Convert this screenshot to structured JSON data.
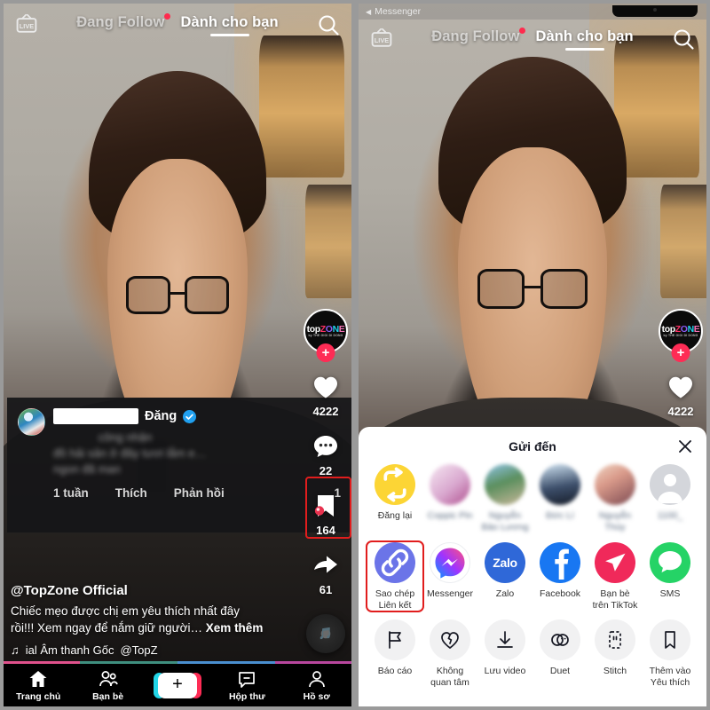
{
  "app": {
    "name": "TikTok"
  },
  "left_panel": {
    "topnav": {
      "live_label": "LIVE",
      "tab_following": "Đang Follow",
      "tab_foryou": "Dành cho bạn",
      "search_icon": "search-icon"
    },
    "rail": {
      "avatar_logo_top": "top",
      "avatar_logo_z": "Z",
      "avatar_logo_o": "O",
      "avatar_logo_n": "N",
      "avatar_logo_e": "E",
      "avatar_sub": "by THE GIOI DI DONG",
      "follow_label": "+",
      "like_count": "4222",
      "comment_count": "22",
      "bookmark_count": "164",
      "share_count": "61"
    },
    "comment": {
      "name": "Đăng",
      "verified": true,
      "text_line1": "công nhận",
      "text_line2": "đồ hải sản ở đây tươi lắm e…",
      "text_line3": "ngon đã man",
      "time": "1 tuần",
      "like_label": "Thích",
      "reply_label": "Phản hồi",
      "like_count": "1"
    },
    "caption": {
      "username": "@TopZone Official",
      "line1": "Chiếc mẹo được chị em yêu thích nhất đây",
      "line2": "rồi!!! Xem ngay để nắm giữ người…",
      "more": "Xem thêm",
      "music_icon": "music-note-icon",
      "music_title": "ial Âm thanh Gốc",
      "music_author": "@TopZ"
    },
    "progress_segments": [
      {
        "color": "#e0518c",
        "width": 22
      },
      {
        "color": "#3f8f7f",
        "width": 28
      },
      {
        "color": "#4a8fd0",
        "width": 28
      },
      {
        "color": "#b8469e",
        "width": 22
      }
    ],
    "bottomnav": [
      {
        "label": "Trang chủ",
        "icon": "home-icon"
      },
      {
        "label": "Bạn bè",
        "icon": "friends-icon"
      },
      {
        "label": "+",
        "icon": "create-icon"
      },
      {
        "label": "Hộp thư",
        "icon": "inbox-icon"
      },
      {
        "label": "Hồ sơ",
        "icon": "profile-icon"
      }
    ]
  },
  "right_panel": {
    "status_bar": {
      "back_icon": "back-triangle-icon",
      "app_label": "Messenger"
    },
    "topnav": {
      "live_label": "LIVE",
      "tab_following": "Đang Follow",
      "tab_foryou": "Dành cho bạn",
      "search_icon": "search-icon"
    },
    "rail": {
      "avatar_logo_top": "top",
      "avatar_logo_z": "Z",
      "avatar_logo_o": "O",
      "avatar_logo_n": "N",
      "avatar_logo_e": "E",
      "avatar_sub": "by THE GIOI DI DONG",
      "follow_label": "+",
      "like_count": "4222"
    },
    "share_sheet": {
      "title": "Gửi đến",
      "close_icon": "close-icon",
      "contacts": [
        {
          "label": "Đăng lại",
          "icon": "repost-icon",
          "style": "repost",
          "blurred": false
        },
        {
          "label": "Coppic Pin",
          "icon": "avatar",
          "style": "ph1",
          "blurred": true
        },
        {
          "label": "Nguyễn\nBảo Lương",
          "icon": "avatar",
          "style": "ph2",
          "blurred": true
        },
        {
          "label": "Đức Lí",
          "icon": "avatar",
          "style": "ph3",
          "blurred": true
        },
        {
          "label": "Nguyễn\nThúy",
          "icon": "avatar",
          "style": "ph4",
          "blurred": true
        },
        {
          "label": "1100_",
          "icon": "person-icon",
          "style": "ph5",
          "blurred": false
        }
      ],
      "apps": [
        {
          "label": "Sao chép\nLiên kết",
          "icon": "link-icon",
          "style": "copylink",
          "highlighted": true
        },
        {
          "label": "Messenger",
          "icon": "messenger-icon",
          "style": "messenger",
          "highlighted": false
        },
        {
          "label": "Zalo",
          "icon": "zalo-icon",
          "style": "zalo",
          "highlighted": false
        },
        {
          "label": "Facebook",
          "icon": "facebook-icon",
          "style": "facebook",
          "highlighted": false
        },
        {
          "label": "Bạn bè\ntrên TikTok",
          "icon": "send-plane-icon",
          "style": "tiktokfriend",
          "highlighted": false
        },
        {
          "label": "SMS",
          "icon": "sms-icon",
          "style": "sms",
          "highlighted": false
        }
      ],
      "actions": [
        {
          "label": "Báo cáo",
          "icon": "flag-icon"
        },
        {
          "label": "Không\nquan tâm",
          "icon": "broken-heart-icon"
        },
        {
          "label": "Lưu video",
          "icon": "download-icon"
        },
        {
          "label": "Duet",
          "icon": "duet-icon"
        },
        {
          "label": "Stitch",
          "icon": "stitch-icon"
        },
        {
          "label": "Thêm vào\nYêu thích",
          "icon": "bookmark-icon"
        }
      ]
    }
  },
  "colors": {
    "accent_pink": "#fe2c55",
    "accent_cyan": "#22d6e8",
    "highlight_red": "#e11d1d",
    "verified_blue": "#20a0f0",
    "repost_yellow": "#fcd535"
  }
}
